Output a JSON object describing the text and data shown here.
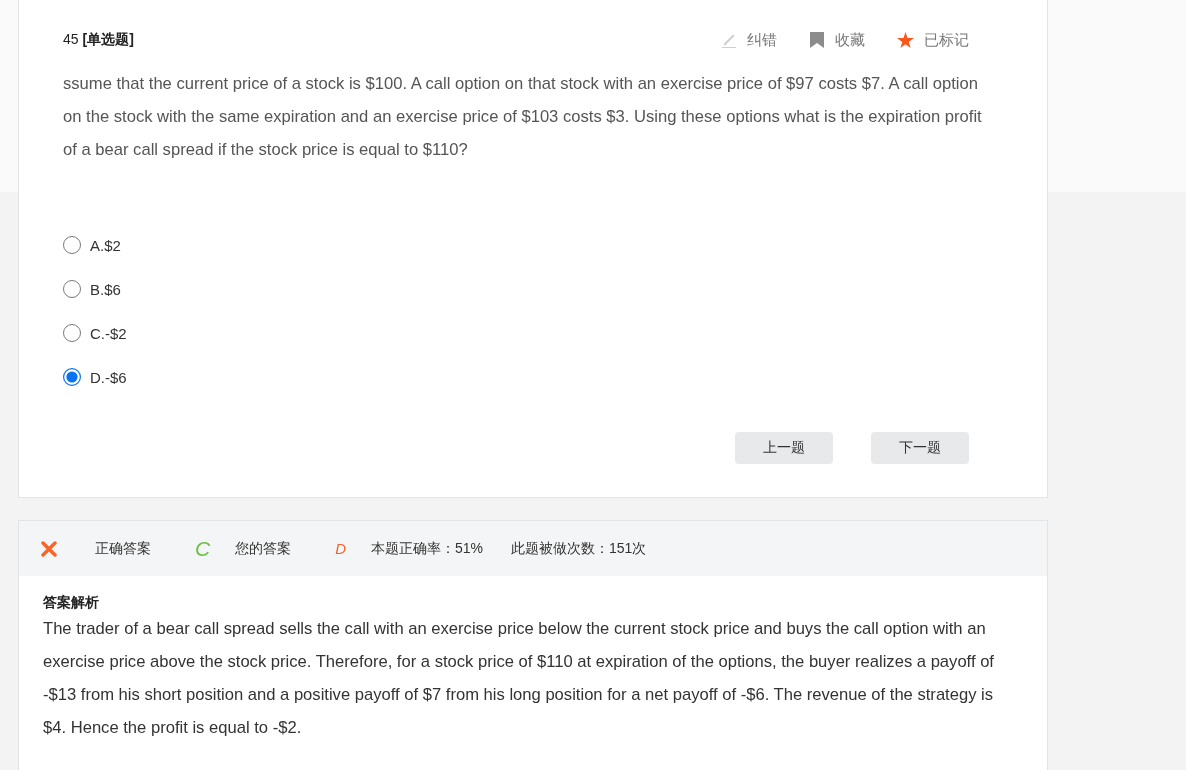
{
  "question": {
    "heading": "45 **[单选题]**",
    "actions": [
      {
        "kind": "report",
        "label": "纠错",
        "active": false
      },
      {
        "kind": "favorite",
        "label": "收藏",
        "active": false
      },
      {
        "kind": "mark",
        "label": "已标记",
        "active": true
      }
    ],
    "text": "ssume that the current price of a stock is $100. A call option on that stock with an exercise price of $97 costs $7. A call option on the stock with the same expiration and an exercise price of $103 costs $3. Using these options what is the expiration profit of a bear call spread if the stock price is equal to $110?",
    "options": [
      {
        "label": "A.$2",
        "selected": false
      },
      {
        "label": "B.$6",
        "selected": false
      },
      {
        "label": "C.-$2",
        "selected": false
      },
      {
        "label": "D.-$6",
        "selected": true
      }
    ],
    "buttons": [
      "上一题",
      "下一题"
    ]
  },
  "answer": {
    "correct": false,
    "correct_answer": {
      "label": "正确答案",
      "value": "C"
    },
    "your_answer": {
      "label": "您的答案",
      "value": "D"
    },
    "stats": [
      "本题正确率：51%",
      "此题被做次数：151次"
    ],
    "explanation_title": "答案解析",
    "explanation": "The trader of a bear call spread sells the call with an exercise price below the current stock price and buys the call option with an exercise price above the stock price. Therefore, for a stock price of $110 at expiration of the options, the buyer realizes a payoff of -$13 from his short position and a positive payoff of $7 from his long position for a net payoff of -$6. The revenue of the strategy is $4. Hence the profit is equal to -$2."
  }
}
